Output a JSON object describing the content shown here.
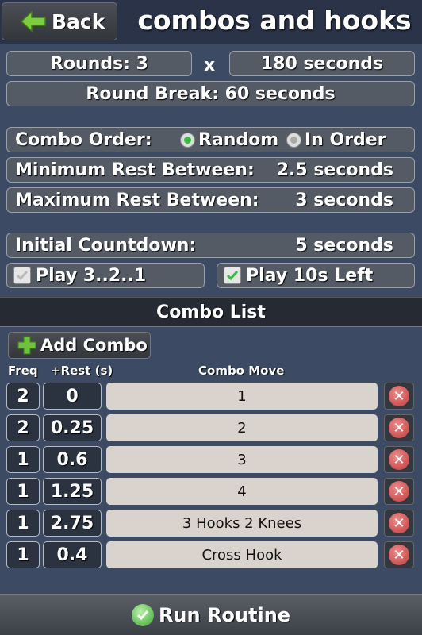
{
  "header": {
    "back_label": "Back",
    "title": "combos and hooks"
  },
  "settings": {
    "rounds": "Rounds: 3",
    "separator": "x",
    "round_length": "180 seconds",
    "round_break": "Round Break: 60 seconds",
    "combo_order_label": "Combo Order:",
    "combo_order_options": {
      "random": "Random",
      "in_order": "In Order"
    },
    "combo_order_selected": "Random",
    "min_rest_label": "Minimum Rest Between:",
    "min_rest_value": "2.5 seconds",
    "max_rest_label": "Maximum Rest Between:",
    "max_rest_value": "3 seconds",
    "countdown_label": "Initial Countdown:",
    "countdown_value": "5 seconds",
    "play_321_label": "Play 3..2..1",
    "play_321_checked": false,
    "play_10s_label": "Play 10s Left",
    "play_10s_checked": true
  },
  "combo_list": {
    "title": "Combo List",
    "add_label": "Add Combo",
    "col_freq": "Freq",
    "col_rest": "+Rest (s)",
    "col_move": "Combo Move",
    "rows": [
      {
        "freq": "2",
        "rest": "0",
        "move": "1"
      },
      {
        "freq": "2",
        "rest": "0.25",
        "move": "2"
      },
      {
        "freq": "1",
        "rest": "0.6",
        "move": "3"
      },
      {
        "freq": "1",
        "rest": "1.25",
        "move": "4"
      },
      {
        "freq": "1",
        "rest": "2.75",
        "move": "3 Hooks 2 Knees"
      },
      {
        "freq": "1",
        "rest": "0.4",
        "move": "Cross Hook"
      }
    ]
  },
  "footer": {
    "run_label": "Run Routine"
  },
  "colors": {
    "accent_green": "#2fbf3a",
    "delete_red": "#c23a3a",
    "background": "#3c4a63"
  }
}
